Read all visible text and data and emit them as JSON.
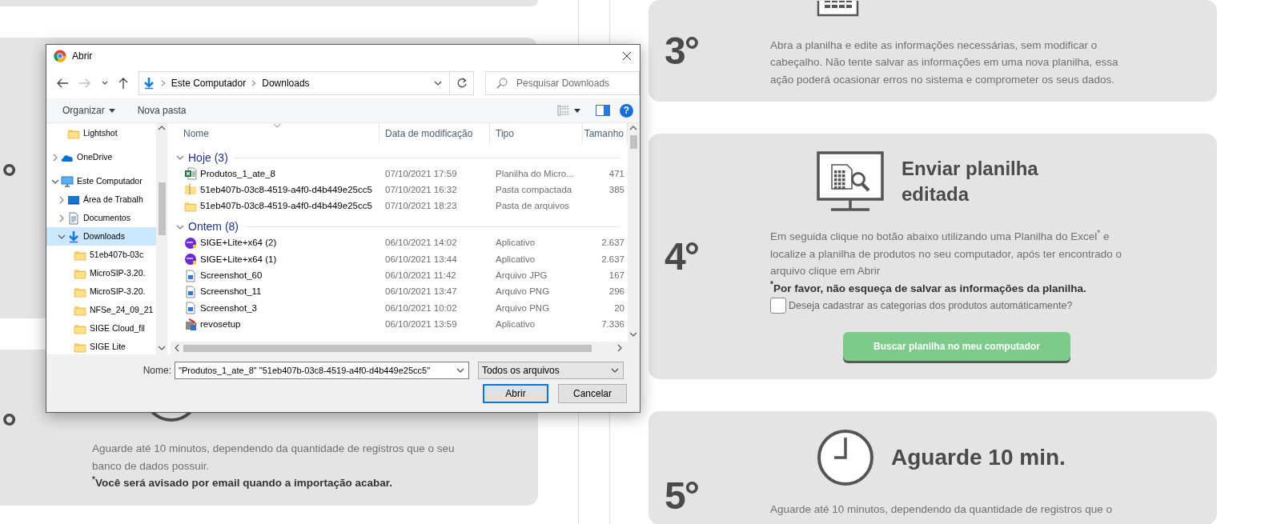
{
  "left_steps": [
    {
      "kind": "covered",
      "number": "°"
    },
    {
      "kind": "bottom",
      "number": "°",
      "paragraph": "Aguarde até 10 minutos, dependendo da quantidade de registros que o seu banco de dados possuir.",
      "note": "$^{*}$Você será avisado por email quando a importação acabar."
    }
  ],
  "right_steps": [
    {
      "kind": "top_cut",
      "number": "3°",
      "paragraph": "Abra a planilha e edite as informações necessárias, sem modificar o cabeçalho. Não tente salvar as informações em uma nova planilha, essa ação poderá ocasionar erros no sistema e comprometer os seus dados."
    },
    {
      "kind": "full",
      "number": "4°",
      "title": "Enviar planilha editada",
      "paragraph": "Em seguida clique no botão abaixo utilizando uma Planilha do Excel$^{*}$ e localize a planilha de produtos no seu computador, após ter encontrado o arquivo clique em Abrir",
      "note": "$^{*}$Por favor, não esqueça de salvar as informações da planilha.",
      "checkbox": {
        "label": "Deseja cadastrar as categorias dos produtos automáticamente?",
        "checked": false
      },
      "button": "Buscar planilha no meu computador"
    },
    {
      "kind": "bottom_cut",
      "number": "5°",
      "title": "Aguarde 10 min.",
      "paragraph": "Aguarde até 10 minutos, dependendo da quantidade de registros que o"
    }
  ],
  "dialog": {
    "title": "Abrir",
    "nav_buttons": [
      {
        "kind": "back",
        "disabled": false
      },
      {
        "kind": "forward",
        "disabled": true
      },
      {
        "kind": "recent",
        "disabled": false
      },
      {
        "kind": "up",
        "disabled": false
      }
    ],
    "breadcrumbs": [
      "Este Computador",
      "Downloads"
    ],
    "search": {
      "placeholder": "Pesquisar Downloads"
    },
    "toolbar": {
      "organize": "Organizar",
      "new_folder": "Nova pasta",
      "help": "?"
    },
    "nav_tree": {
      "partial_children": [
        {
          "label": "Lightshot",
          "kind": "folder",
          "expandable": false,
          "selected": false
        }
      ],
      "items": [
        {
          "label": "OneDrive",
          "kind": "cloud",
          "expandable": true,
          "expanded": false,
          "selected": false
        },
        {
          "label": "Este Computador",
          "kind": "computer",
          "expandable": true,
          "expanded": true,
          "selected": false,
          "children": [
            {
              "label": "Área de Trabalh",
              "kind": "desktop",
              "expandable": true,
              "expanded": false,
              "selected": false
            },
            {
              "label": "Documentos",
              "kind": "document",
              "expandable": true,
              "expanded": false,
              "selected": false
            },
            {
              "label": "Downloads",
              "kind": "download",
              "expandable": true,
              "expanded": true,
              "selected": true,
              "children": [
                {
                  "label": "51eb407b-03c",
                  "kind": "folder",
                  "expandable": false,
                  "selected": false
                },
                {
                  "label": "MicroSIP-3.20.",
                  "kind": "folder",
                  "expandable": false,
                  "selected": false
                },
                {
                  "label": "MicroSIP-3.20.",
                  "kind": "folder",
                  "expandable": false,
                  "selected": false
                },
                {
                  "label": "NFSe_24_09_21",
                  "kind": "folder",
                  "expandable": false,
                  "selected": false
                },
                {
                  "label": "SIGE Cloud_fil",
                  "kind": "folder",
                  "expandable": false,
                  "selected": false
                },
                {
                  "label": "SIGE Lite",
                  "kind": "folder",
                  "expandable": false,
                  "selected": false
                }
              ]
            }
          ]
        }
      ]
    },
    "columns": [
      "Nome",
      "Data de modificação",
      "Tipo",
      "Tamanho"
    ],
    "groups": [
      {
        "label": "Hoje (3)",
        "expanded": true,
        "files": [
          {
            "name": "Produtos_1_ate_8",
            "kind": "excel",
            "date": "07/10/2021 17:59",
            "type": "Planilha do Micro...",
            "size": "471"
          },
          {
            "name": "51eb407b-03c8-4519-a4f0-d4b449e25cc5",
            "kind": "zip",
            "date": "07/10/2021 16:32",
            "type": "Pasta compactada",
            "size": "385"
          },
          {
            "name": "51eb407b-03c8-4519-a4f0-d4b449e25cc5",
            "kind": "folder",
            "date": "07/10/2021 18:23",
            "type": "Pasta de arquivos"
          }
        ]
      },
      {
        "label": "Ontem (8)",
        "expanded": true,
        "files": [
          {
            "name": "SIGE+Lite+x64 (2)",
            "kind": "app",
            "date": "06/10/2021 14:02",
            "type": "Aplicativo",
            "size": "2.637"
          },
          {
            "name": "SIGE+Lite+x64 (1)",
            "kind": "app",
            "date": "06/10/2021 13:44",
            "type": "Aplicativo",
            "size": "2.637"
          },
          {
            "name": "Screenshot_60",
            "kind": "image",
            "date": "06/10/2021 11:42",
            "type": "Arquivo JPG",
            "size": "167"
          },
          {
            "name": "Screenshot_11",
            "kind": "image",
            "date": "06/10/2021 13:47",
            "type": "Arquivo PNG",
            "size": "296"
          },
          {
            "name": "Screenshot_3",
            "kind": "image",
            "date": "06/10/2021 10:02",
            "type": "Arquivo PNG",
            "size": "20"
          },
          {
            "name": "revosetup",
            "kind": "installer",
            "date": "06/10/2021 13:59",
            "type": "Aplicativo",
            "size": "7.336"
          }
        ]
      }
    ],
    "filename_label": "Nome:",
    "filename": "\"Produtos_1_ate_8\" \"51eb407b-03c8-4519-a4f0-d4b449e25cc5\"",
    "filetype": "Todos os arquivos",
    "buttons": [
      {
        "label": "Abrir",
        "default": true
      },
      {
        "label": "Cancelar",
        "default": false
      }
    ]
  }
}
